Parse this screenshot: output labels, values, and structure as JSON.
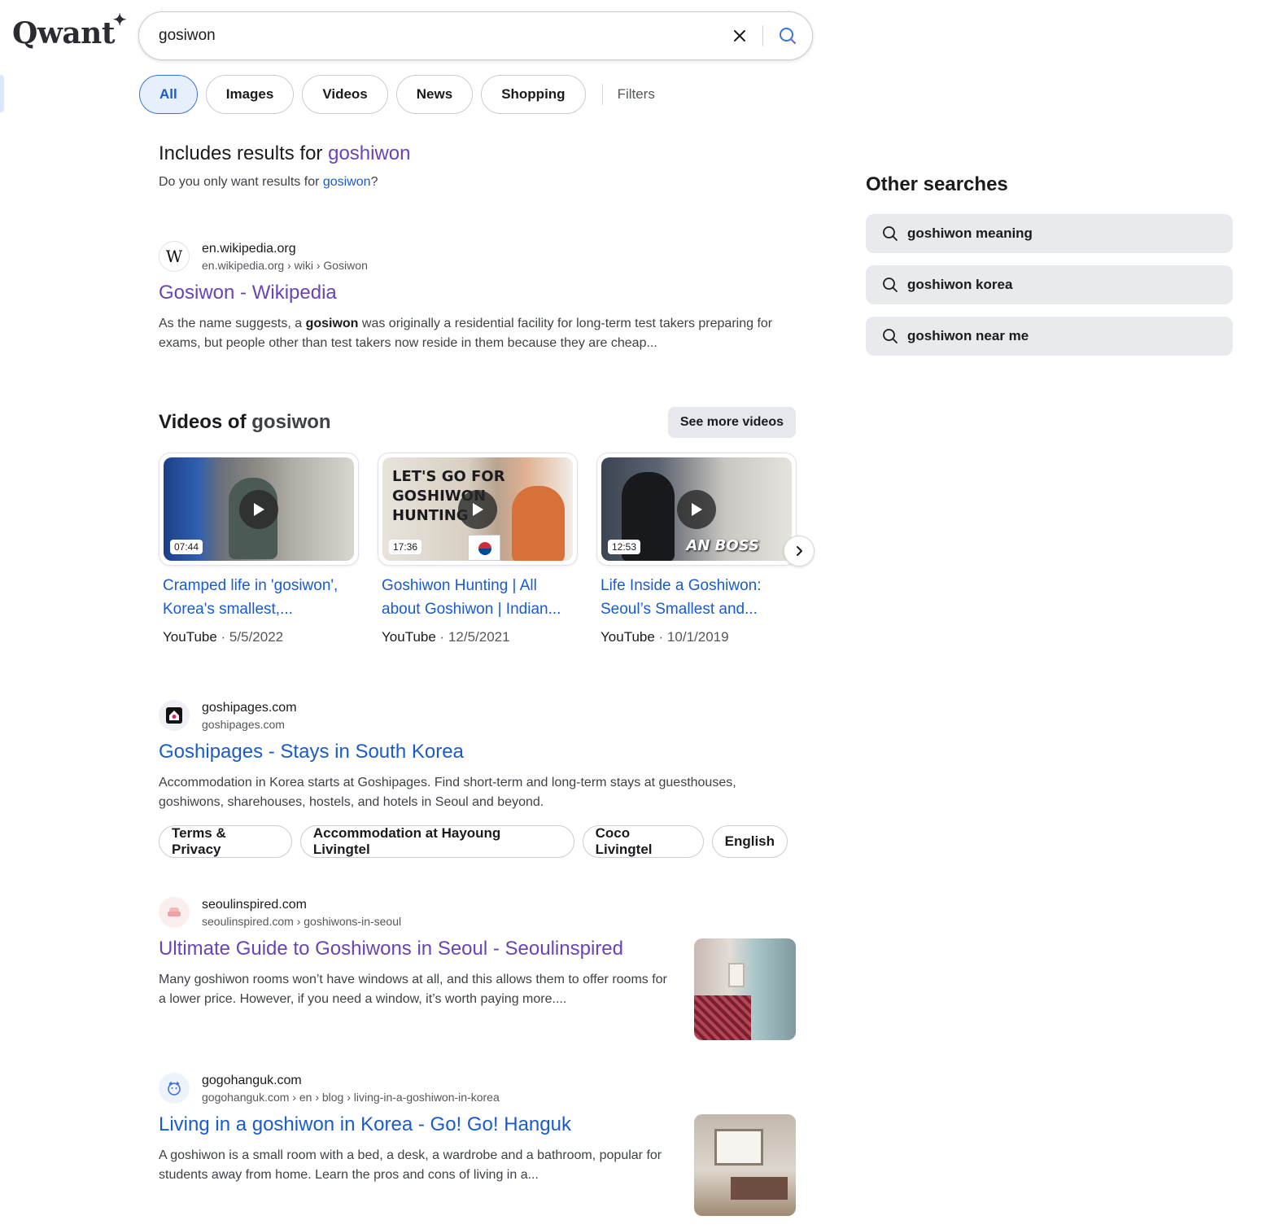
{
  "logo": "Qwant",
  "search": {
    "query": "gosiwon"
  },
  "tabs": {
    "all": "All",
    "images": "Images",
    "videos": "Videos",
    "news": "News",
    "shopping": "Shopping",
    "filters": "Filters"
  },
  "spelling": {
    "includes_prefix": "Includes results for",
    "corrected": "goshiwon",
    "only_prefix": "Do you only want results for",
    "original": "gosiwon",
    "only_suffix": "?"
  },
  "results": [
    {
      "domain": "en.wikipedia.org",
      "path": "en.wikipedia.org › wiki › Gosiwon",
      "title": "Gosiwon - Wikipedia",
      "desc_pre": "As the name suggests, a",
      "desc_bold": "gosiwon",
      "desc_post": "was originally a residential facility for long-term test takers preparing for exams, but people other than test takers now reside in them because they are cheap..."
    },
    {
      "domain": "goshipages.com",
      "path": "goshipages.com",
      "title": "Goshipages - Stays in South Korea",
      "desc": "Accommodation in Korea starts at Goshipages. Find short-term and long-term stays at guesthouses, goshiwons, sharehouses, hostels, and hotels in Seoul and beyond.",
      "sitelinks": [
        "Terms & Privacy",
        "Accommodation at Hayoung Livingtel",
        "Coco Livingtel",
        "English"
      ]
    },
    {
      "domain": "seoulinspired.com",
      "path": "seoulinspired.com › goshiwons-in-seoul",
      "title": "Ultimate Guide to Goshiwons in Seoul - Seoulinspired",
      "desc": "Many goshiwon rooms won’t have windows at all, and this allows them to offer rooms for a lower price. However, if you need a window, it’s worth paying more...."
    },
    {
      "domain": "gogohanguk.com",
      "path": "gogohanguk.com › en › blog › living-in-a-goshiwon-in-korea",
      "title": "Living in a goshiwon in Korea - Go! Go! Hanguk",
      "desc": "A goshiwon is a small room with a bed, a desk, a wardrobe and a bathroom, popular for students away from home. Learn the pros and cons of living in a..."
    }
  ],
  "videos": {
    "heading_prefix": "Videos of",
    "heading_query": "gosiwon",
    "see_more": "See more videos",
    "items": [
      {
        "title": "Cramped life in 'gosiwon', Korea's smallest,...",
        "source": "YouTube",
        "date": "· 5/5/2022",
        "duration": "07:44"
      },
      {
        "title": "Goshiwon Hunting | All about Goshiwon | Indian...",
        "source": "YouTube",
        "date": "· 12/5/2021",
        "duration": "17:36",
        "overlay": "LET'S GO FOR GOSHIWON HUNTING"
      },
      {
        "title": "Life Inside a Goshiwon: Seoul’s Smallest and...",
        "source": "YouTube",
        "date": "· 10/1/2019",
        "duration": "12:53",
        "overlay": "AN BOSS"
      }
    ]
  },
  "sidebar": {
    "title": "Other searches",
    "items": [
      "goshiwon meaning",
      "goshiwon korea",
      "goshiwon near me"
    ]
  },
  "colors": {
    "link": "#1a5bce",
    "visited": "#6944b8",
    "chip_bg": "#e8eaee"
  }
}
